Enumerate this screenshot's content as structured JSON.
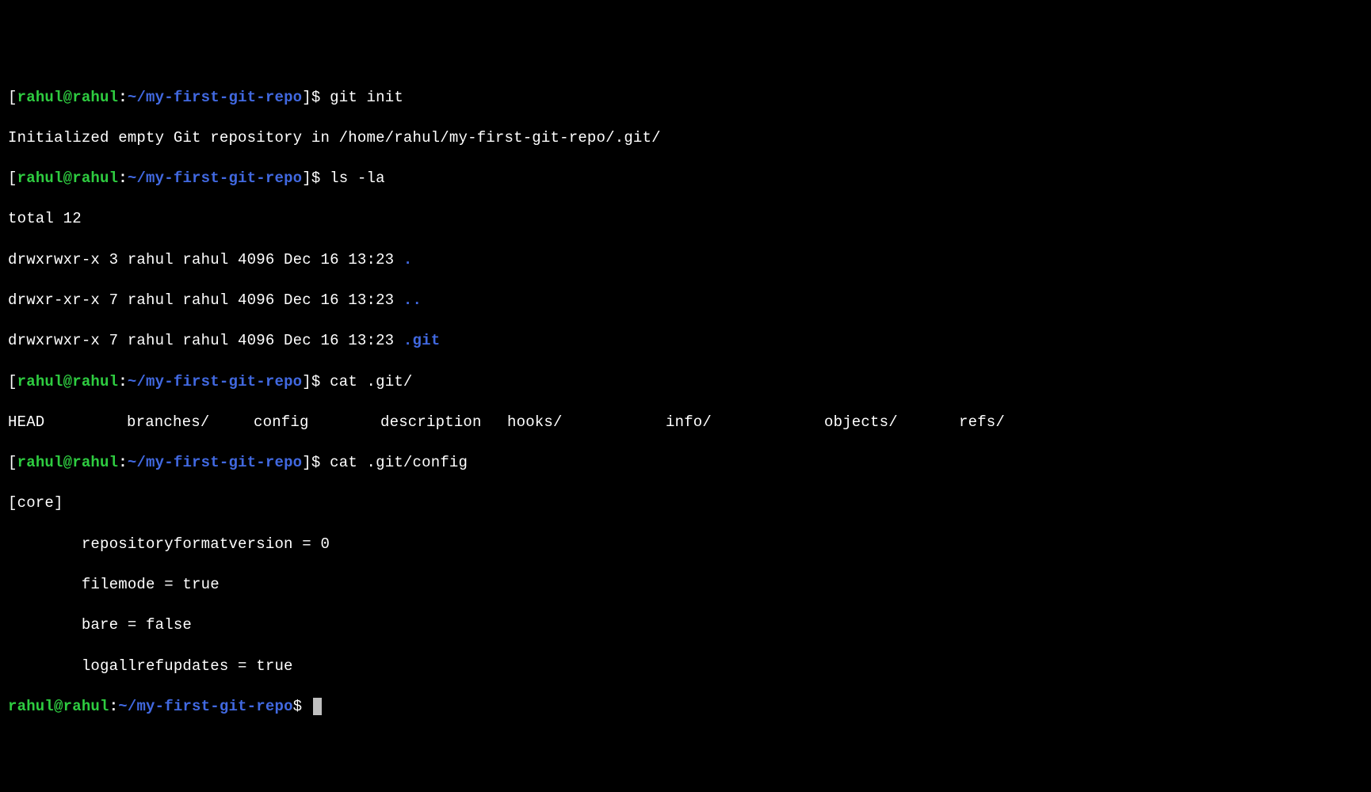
{
  "prompt": {
    "open_bracket": "[",
    "close_bracket": "]",
    "user_host": "rahul@rahul",
    "colon": ":",
    "path": "~/my-first-git-repo",
    "dollar": "$"
  },
  "commands": {
    "git_init": "git init",
    "ls_la": "ls -la",
    "cat_git_dir": "cat .git/",
    "cat_git_config": "cat .git/config"
  },
  "output": {
    "init_msg": "Initialized empty Git repository in /home/rahul/my-first-git-repo/.git/",
    "ls": {
      "total": "total 12",
      "row1_perm": "drwxrwxr-x 3 rahul rahul 4096 Dec 16 13:23 ",
      "row1_name": ".",
      "row2_perm": "drwxr-xr-x 7 rahul rahul 4096 Dec 16 13:23 ",
      "row2_name": "..",
      "row3_perm": "drwxrwxr-x 7 rahul rahul 4096 Dec 16 13:23 ",
      "row3_name": ".git"
    },
    "git_contents": {
      "c1": "HEAD",
      "c2": "branches/",
      "c3": "config",
      "c4": "description",
      "c5": "hooks/",
      "c6": "info/",
      "c7": "objects/",
      "c8": "refs/"
    },
    "config": {
      "section": "[core]",
      "l1": "        repositoryformatversion = 0",
      "l2": "        filemode = true",
      "l3": "        bare = false",
      "l4": "        logallrefupdates = true"
    }
  }
}
